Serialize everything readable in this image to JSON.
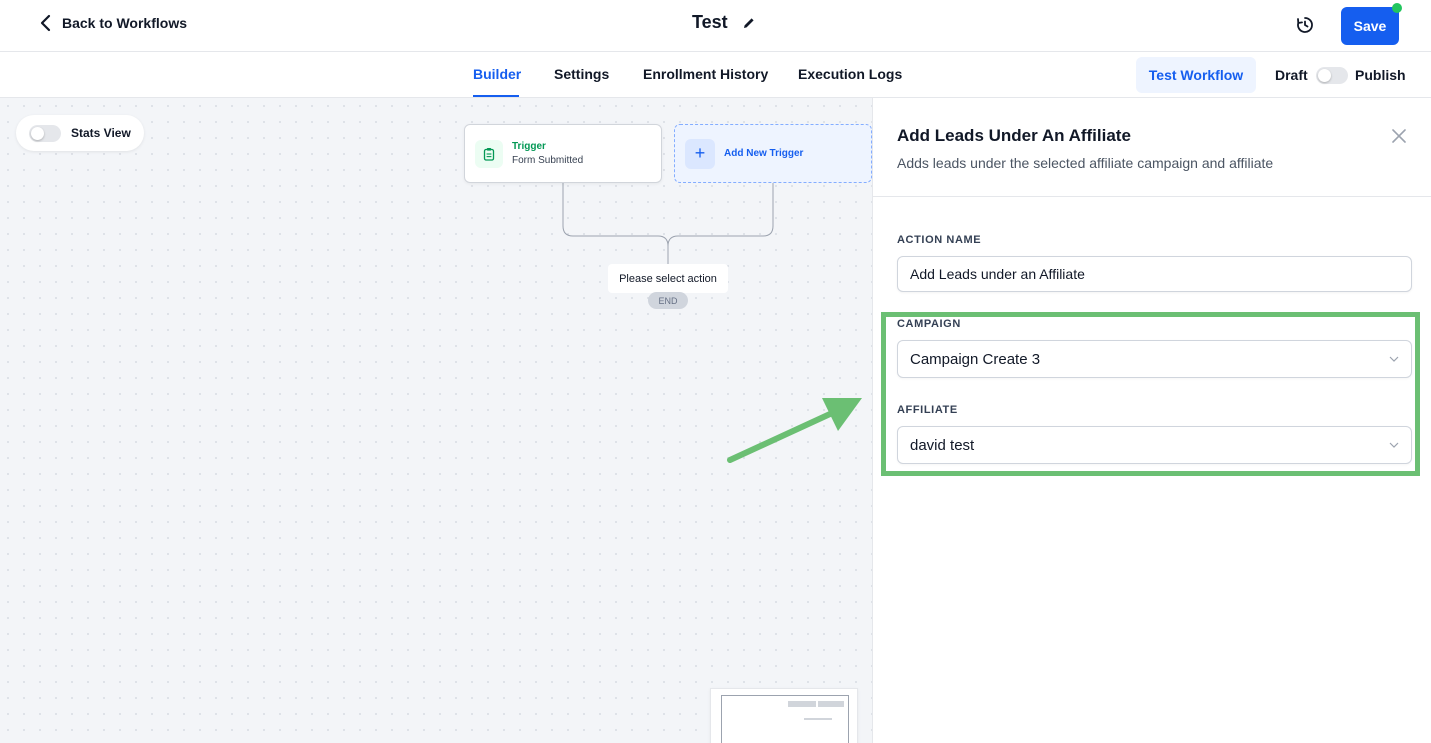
{
  "header": {
    "back_label": "Back to Workflows",
    "title": "Test",
    "save_label": "Save"
  },
  "tabs": [
    {
      "label": "Builder",
      "active": true
    },
    {
      "label": "Settings",
      "active": false
    },
    {
      "label": "Enrollment History",
      "active": false
    },
    {
      "label": "Execution Logs",
      "active": false
    }
  ],
  "toolbar": {
    "test_workflow_label": "Test Workflow",
    "draft_label": "Draft",
    "publish_label": "Publish"
  },
  "canvas": {
    "stats_view_label": "Stats View",
    "trigger_node": {
      "title": "Trigger",
      "subtitle": "Form Submitted"
    },
    "add_trigger_label": "Add New Trigger",
    "action_placeholder": "Please select action",
    "end_label": "END"
  },
  "panel": {
    "title": "Add Leads Under An Affiliate",
    "description": "Adds leads under the selected affiliate campaign and affiliate",
    "action_name_label": "ACTION NAME",
    "action_name_value": "Add Leads under an Affiliate",
    "campaign_label": "CAMPAIGN",
    "campaign_value": "Campaign Create 3",
    "affiliate_label": "AFFILIATE",
    "affiliate_value": "david test"
  },
  "colors": {
    "accent": "#155eef",
    "highlight": "#6bbf73",
    "trigger_green": "#039855",
    "status_dot": "#22c55e"
  }
}
